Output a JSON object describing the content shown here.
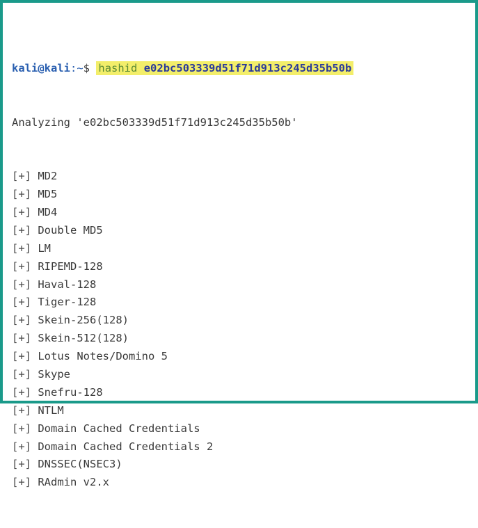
{
  "prompt": {
    "user_host": "kali@kali",
    "path": ":~",
    "sign": "$",
    "command": "hashid",
    "argument": "e02bc503339d51f71d913c245d35b50b"
  },
  "analyzing_line": "Analyzing 'e02bc503339d51f71d913c245d35b50b'",
  "result_prefix": "[+]",
  "results": [
    "MD2",
    "MD5",
    "MD4",
    "Double MD5",
    "LM",
    "RIPEMD-128",
    "Haval-128",
    "Tiger-128",
    "Skein-256(128)",
    "Skein-512(128)",
    "Lotus Notes/Domino 5",
    "Skype",
    "Snefru-128",
    "NTLM",
    "Domain Cached Credentials",
    "Domain Cached Credentials 2",
    "DNSSEC(NSEC3)",
    "RAdmin v2.x"
  ]
}
